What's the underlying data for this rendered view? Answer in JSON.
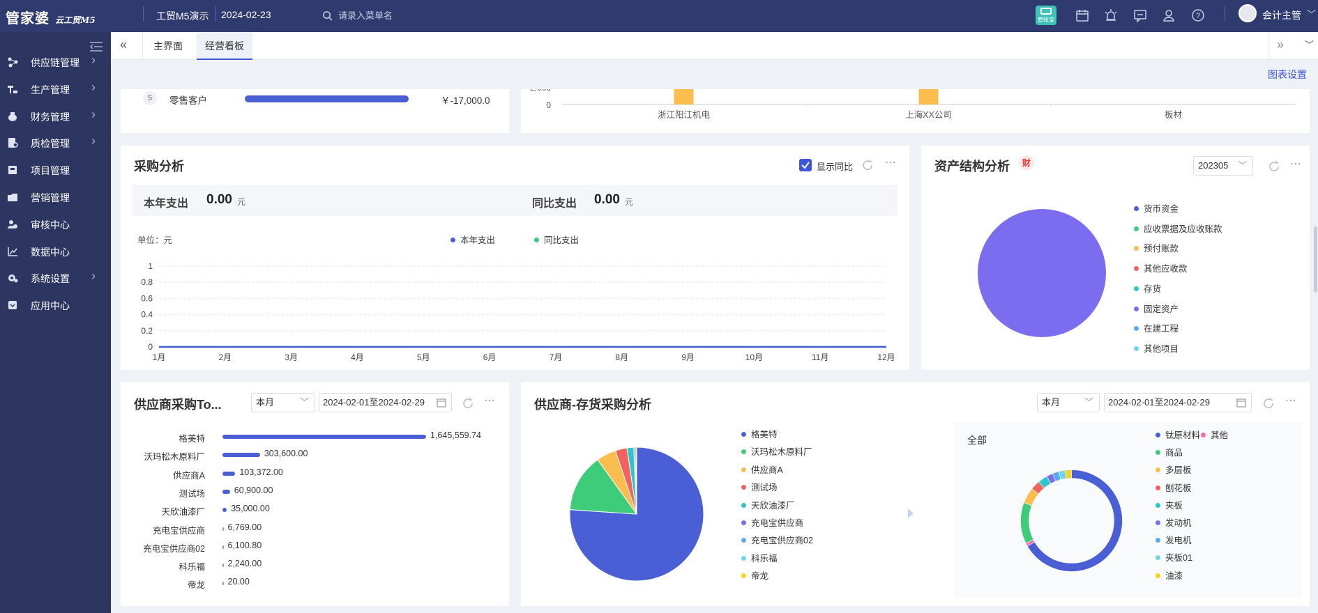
{
  "topbar": {
    "logo_main": "管家婆",
    "logo_sub": "云工贸M5",
    "company": "工贸M5演示",
    "date": "2024-02-23",
    "search_placeholder": "请录入菜单名",
    "user_name": "会计主管",
    "badge_label": "管账宝",
    "icons": [
      "calendar-icon",
      "alarm-icon",
      "message-icon",
      "contact-icon",
      "help-icon"
    ]
  },
  "sidebar": {
    "items": [
      {
        "label": "供应链管理",
        "icon": "supply-chain-icon",
        "has_arrow": true
      },
      {
        "label": "生产管理",
        "icon": "production-icon",
        "has_arrow": true
      },
      {
        "label": "财务管理",
        "icon": "finance-icon",
        "has_arrow": true
      },
      {
        "label": "质检管理",
        "icon": "quality-icon",
        "has_arrow": true
      },
      {
        "label": "项目管理",
        "icon": "project-icon",
        "has_arrow": false
      },
      {
        "label": "营销管理",
        "icon": "marketing-icon",
        "has_arrow": false
      },
      {
        "label": "审核中心",
        "icon": "audit-icon",
        "has_arrow": false
      },
      {
        "label": "数据中心",
        "icon": "data-icon",
        "has_arrow": false
      },
      {
        "label": "系统设置",
        "icon": "settings-icon",
        "has_arrow": true
      },
      {
        "label": "应用中心",
        "icon": "app-icon",
        "has_arrow": false
      }
    ]
  },
  "tabs": [
    {
      "label": "主界面",
      "active": false
    },
    {
      "label": "经营看板",
      "active": true
    }
  ],
  "chart_settings": "图表设置",
  "top_left_row": {
    "rank": "5",
    "name": "零售客户",
    "value": "￥-17,000.0",
    "fill": 1.0
  },
  "top_right_chart": {
    "chart_data": {
      "type": "bar",
      "categories": [
        "浙江阳江机电",
        "上海XX公司",
        "板材"
      ],
      "yticks": [
        "2,000",
        "0"
      ],
      "color": "#fbbd4e"
    }
  },
  "purchase": {
    "title": "采购分析",
    "toggle_label": "显示同比",
    "toggle_checked": true,
    "year_label": "本年支出",
    "year_value": "0.00",
    "year_unit": "元",
    "yoy_label": "同比支出",
    "yoy_value": "0.00",
    "yoy_unit": "元",
    "unit": "单位：元",
    "chart_data": {
      "type": "line",
      "categories": [
        "1月",
        "2月",
        "3月",
        "4月",
        "5月",
        "6月",
        "7月",
        "8月",
        "9月",
        "10月",
        "11月",
        "12月"
      ],
      "series": [
        {
          "name": "本年支出",
          "color": "#4a5fd6",
          "values": [
            0,
            0,
            0,
            0,
            0,
            0,
            0,
            0,
            0,
            0,
            0,
            0
          ]
        },
        {
          "name": "同比支出",
          "color": "#3ecb7a",
          "values": [
            0,
            0,
            0,
            0,
            0,
            0,
            0,
            0,
            0,
            0,
            0,
            0
          ]
        }
      ],
      "ylim": [
        0,
        1
      ],
      "yticks": [
        "1",
        "0.8",
        "0.6",
        "0.4",
        "0.2",
        "0"
      ]
    }
  },
  "asset": {
    "title": "资产结构分析",
    "badge": "财",
    "period": "202305",
    "chart_data": {
      "type": "pie",
      "labels": [
        "货币资金",
        "应收票据及应收账款",
        "预付账款",
        "其他应收款",
        "存货",
        "固定资产",
        "在建工程",
        "其他项目"
      ],
      "colors": [
        "#4a5fd6",
        "#3ecb7a",
        "#fbbd4e",
        "#f2635f",
        "#2ec7c9",
        "#7c6cf0",
        "#5aa9f4",
        "#6fd4f2"
      ],
      "values": [
        0,
        0,
        0,
        0,
        0,
        100,
        0,
        0
      ]
    }
  },
  "supplier_top": {
    "title": "供应商采购To...",
    "period": "本月",
    "date_range": "2024-02-01至2024-02-29",
    "chart_data": {
      "type": "bar",
      "categories": [
        "格美特",
        "沃玛松木原料厂",
        "供应商A",
        "测试场",
        "天欣油漆厂",
        "充电宝供应商",
        "充电宝供应商02",
        "科乐福",
        "帝龙"
      ],
      "values": [
        1645559.74,
        303600.0,
        103372.0,
        60900.0,
        35000.0,
        6769.0,
        6100.8,
        2240.0,
        20.0
      ],
      "labels": [
        "1,645,559.74",
        "303,600.00",
        "103,372.00",
        "60,900.00",
        "35,000.00",
        "6,769.00",
        "6,100.80",
        "2,240.00",
        "20.00"
      ]
    }
  },
  "supplier_inventory": {
    "title": "供应商-存货采购分析",
    "period": "本月",
    "date_range": "2024-02-01至2024-02-29",
    "pie": {
      "chart_data": {
        "type": "pie",
        "labels": [
          "格美特",
          "沃玛松木原料厂",
          "供应商A",
          "测试场",
          "天欣油漆厂",
          "充电宝供应商",
          "充电宝供应商02",
          "科乐福",
          "帝龙"
        ],
        "colors": [
          "#4a5fd6",
          "#3ecb7a",
          "#fbbd4e",
          "#f2635f",
          "#2ec7c9",
          "#7c6cf0",
          "#5aa9f4",
          "#6fd4f2",
          "#f5d31f"
        ],
        "values": [
          1645559.74,
          303600.0,
          103372.0,
          60900.0,
          35000.0,
          6769.0,
          6100.8,
          2240.0,
          20.0
        ]
      }
    },
    "donut": {
      "filter": "全部",
      "chart_data": {
        "type": "pie",
        "labels": [
          "钛原材料",
          "其他",
          "商品",
          "多层板",
          "刨花板",
          "夹板",
          "发动机",
          "发电机",
          "夹板01",
          "油漆"
        ],
        "colors": [
          "#4a5fd6",
          "#f26fb0",
          "#3ecb7a",
          "#fbbd4e",
          "#f2635f",
          "#2ec7c9",
          "#7c6cf0",
          "#5aa9f4",
          "#6fd4f2",
          "#f5d31f"
        ],
        "values": [
          66,
          1,
          13,
          5,
          3,
          3,
          2,
          2,
          2,
          2
        ]
      }
    }
  }
}
